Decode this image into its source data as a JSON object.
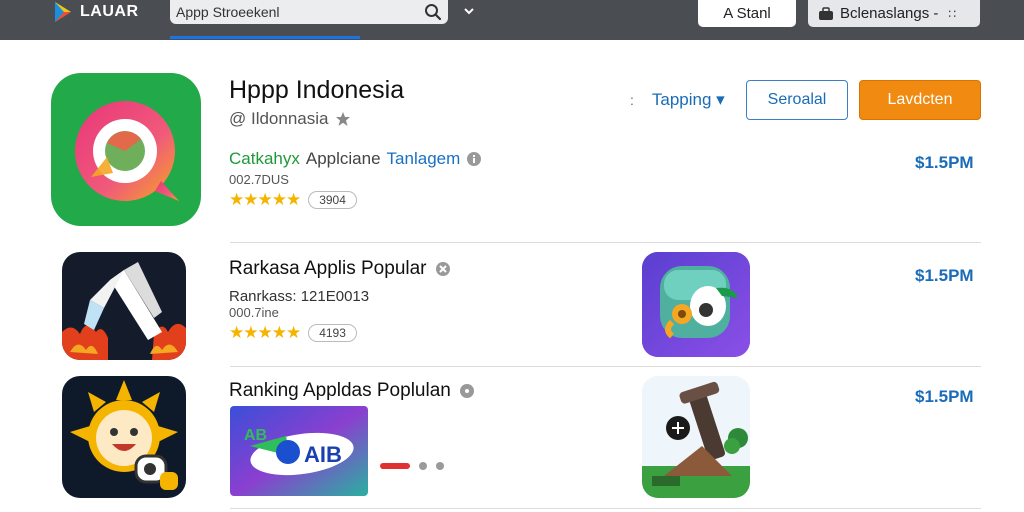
{
  "header": {
    "logo_text": "LAUAR",
    "search_value": "Appp Stroeekenl",
    "store_label": "A Stanl",
    "lang_label": "Bclenaslangs -",
    "grid_glyph": "∷"
  },
  "featured": {
    "title": "Hppp Indonesia",
    "developer": "@ Ildonnasia",
    "category_green": "Catkahyx",
    "category_gray": "Applciane",
    "category_blue": "Tanlagem",
    "size": "002.7DUS",
    "stars": "★★★★★",
    "rating_count": "3904",
    "tapping_dots": ":",
    "tapping_label": "Tapping ▾",
    "special_label": "Seroalal",
    "install_label": "Lavdcten",
    "price": "$1.5PM"
  },
  "rows": [
    {
      "title": "Rarkasa Applis Popular",
      "sub": "Ranrkass: 121E0013",
      "size": "000.7ine",
      "stars": "★★★★★",
      "rating_count": "4193",
      "price": "$1.5PM"
    },
    {
      "title": "Ranking Appldas Poplulan",
      "banner_text": "AIB",
      "banner_letters": "AB",
      "price": "$1.5PM"
    }
  ],
  "colors": {
    "accent_blue": "#1a6cb8",
    "install_orange": "#f08a10",
    "star_yellow": "#f5b400",
    "topbar": "#4a4d52"
  }
}
